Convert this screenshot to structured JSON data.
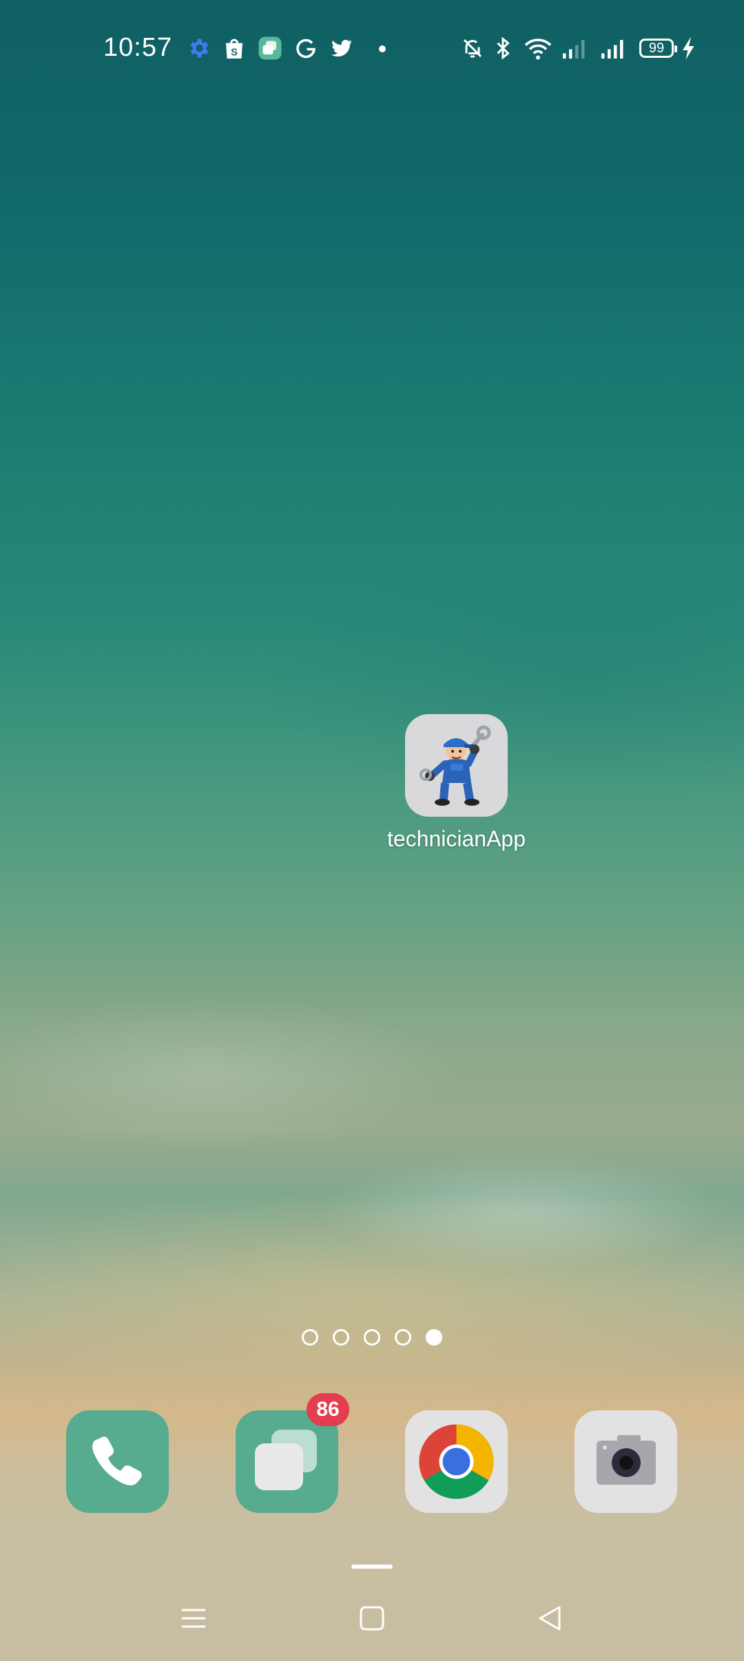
{
  "status_bar": {
    "time": "10:57",
    "battery": "99",
    "icons": [
      "settings-gear-icon",
      "shopping-bag-icon",
      "messages-app-icon",
      "grammarly-icon",
      "twitter-icon",
      "dot-icon",
      "silent-mode-icon",
      "bluetooth-icon",
      "wifi-icon",
      "signal-weak-icon",
      "signal-strong-icon",
      "charging-icon"
    ]
  },
  "home": {
    "app": {
      "label": "technicianApp"
    },
    "pages": {
      "count": 5,
      "active_index": 4
    }
  },
  "dock": {
    "apps": [
      {
        "name": "Phone"
      },
      {
        "name": "Messages",
        "badge": "86"
      },
      {
        "name": "Chrome"
      },
      {
        "name": "Camera"
      }
    ]
  },
  "nav": {
    "buttons": [
      "recents",
      "home",
      "back"
    ]
  }
}
